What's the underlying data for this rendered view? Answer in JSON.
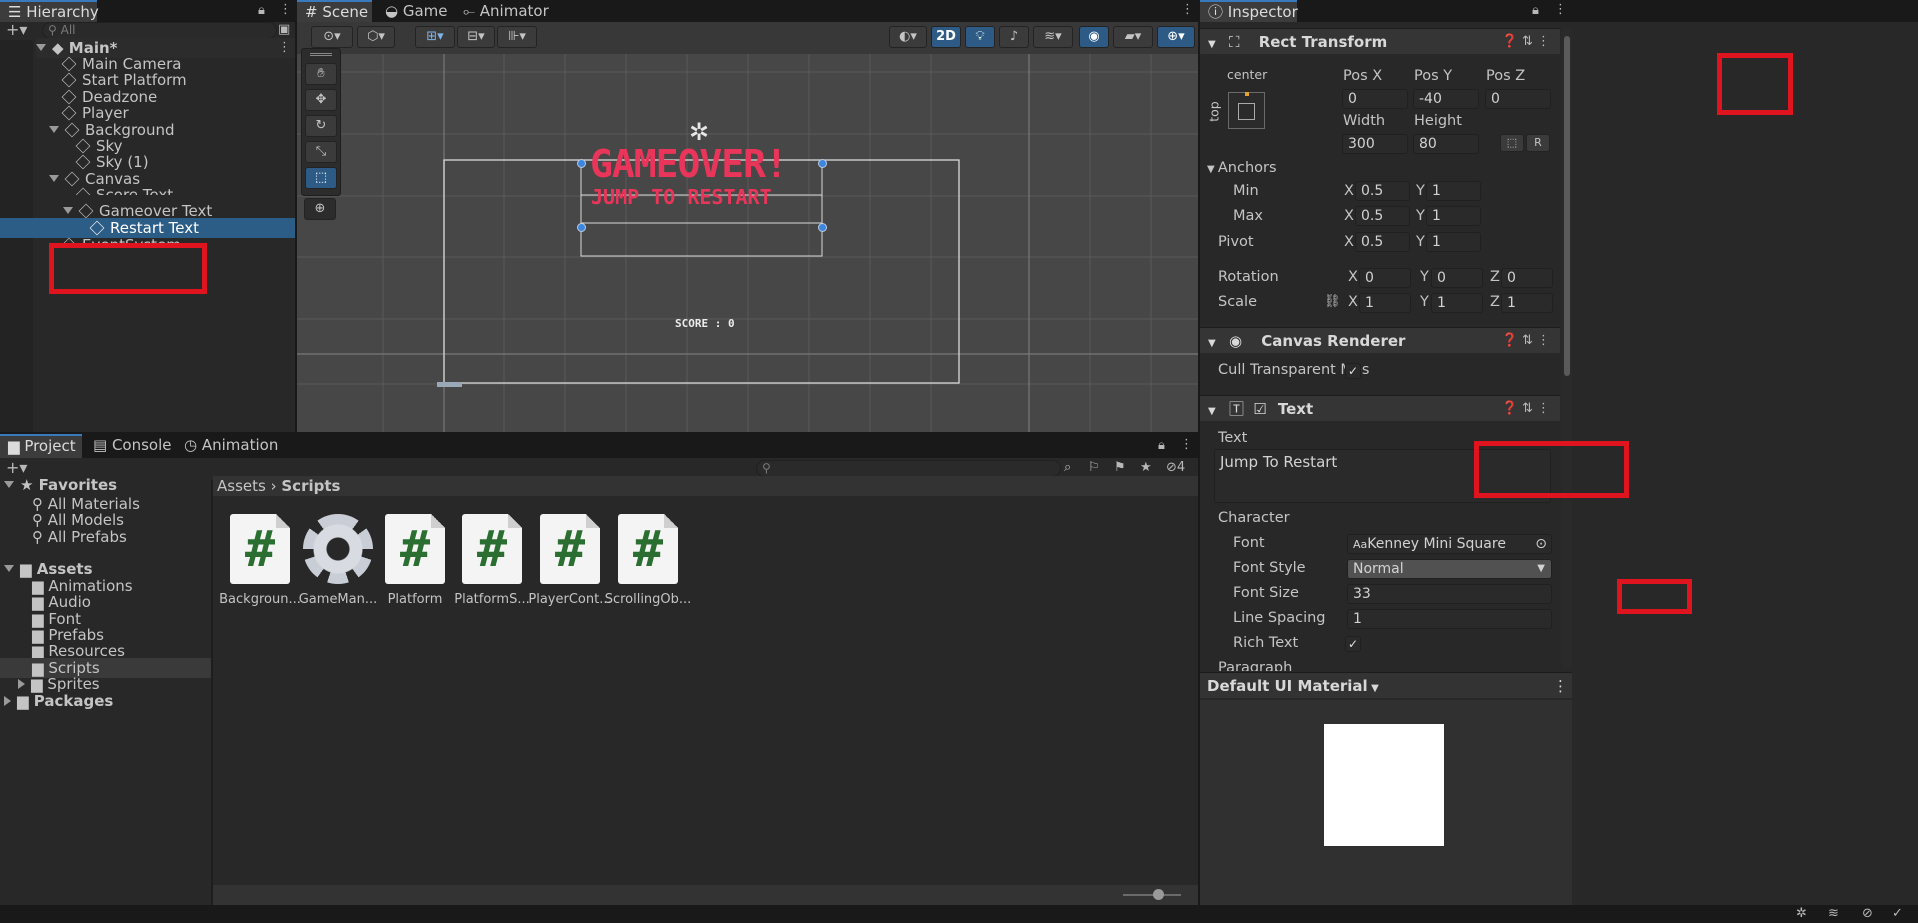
{
  "hierarchy": {
    "tab": "Hierarchy",
    "search_placeholder": "All",
    "scene": "Main*",
    "items": [
      {
        "label": "Main Camera"
      },
      {
        "label": "Start Platform"
      },
      {
        "label": "Deadzone"
      },
      {
        "label": "Player"
      },
      {
        "label": "Background"
      },
      {
        "label": "Sky"
      },
      {
        "label": "Sky (1)"
      },
      {
        "label": "Canvas"
      },
      {
        "label": "Score Text"
      },
      {
        "label": "Gameover Text"
      },
      {
        "label": "Restart Text"
      },
      {
        "label": "EventSystem"
      }
    ]
  },
  "scene": {
    "tabs": [
      "Scene",
      "Game",
      "Animator"
    ],
    "toolbar_2d": "2D",
    "gameover_text": "GAMEOVER!",
    "restart_text": "JUMP TO RESTART",
    "score_text": "SCORE : 0",
    "colors": {
      "accent": "#e9355a",
      "bg": "#474747"
    }
  },
  "inspector": {
    "tab": "Inspector",
    "rect_transform": {
      "title": "Rect Transform",
      "anchor_preset_h": "center",
      "anchor_preset_v": "top",
      "pos_x_label": "Pos X",
      "pos_x": "0",
      "pos_y_label": "Pos Y",
      "pos_y": "-40",
      "pos_z_label": "Pos Z",
      "pos_z": "0",
      "width_label": "Width",
      "width": "300",
      "height_label": "Height",
      "height": "80",
      "r_label": "R",
      "anchors_label": "Anchors",
      "min_label": "Min",
      "min_x": "0.5",
      "min_y": "1",
      "max_label": "Max",
      "max_x": "0.5",
      "max_y": "1",
      "pivot_label": "Pivot",
      "pivot_x": "0.5",
      "pivot_y": "1",
      "rotation_label": "Rotation",
      "rot_x": "0",
      "rot_y": "0",
      "rot_z": "0",
      "scale_label": "Scale",
      "scale_x": "1",
      "scale_y": "1",
      "scale_z": "1",
      "x": "X",
      "y": "Y",
      "z": "Z"
    },
    "canvas_renderer": {
      "title": "Canvas Renderer",
      "cull_label": "Cull Transparent Mes"
    },
    "text": {
      "title": "Text",
      "text_label": "Text",
      "text_value": "Jump To Restart",
      "character_label": "Character",
      "font_label": "Font",
      "font_value": "Kenney Mini Square",
      "font_style_label": "Font Style",
      "font_style_value": "Normal",
      "font_size_label": "Font Size",
      "font_size_value": "33",
      "line_spacing_label": "Line Spacing",
      "line_spacing_value": "1",
      "rich_text_label": "Rich Text",
      "paragraph_label": "Paragraph"
    },
    "material": "Default UI Material"
  },
  "project": {
    "tabs": [
      "Project",
      "Console",
      "Animation"
    ],
    "hidden_count": "4",
    "favorites_label": "Favorites",
    "favorites": [
      "All Materials",
      "All Models",
      "All Prefabs"
    ],
    "assets_label": "Assets",
    "folders": [
      "Animations",
      "Audio",
      "Font",
      "Prefabs",
      "Resources",
      "Scripts",
      "Sprites"
    ],
    "packages_label": "Packages",
    "breadcrumb": [
      "Assets",
      "Scripts"
    ],
    "files": [
      {
        "name": "Backgroun...",
        "icon": "script-icon"
      },
      {
        "name": "GameMan...",
        "icon": "gear-icon"
      },
      {
        "name": "Platform",
        "icon": "script-icon"
      },
      {
        "name": "PlatformS...",
        "icon": "script-icon"
      },
      {
        "name": "PlayerCont...",
        "icon": "script-icon"
      },
      {
        "name": "ScrollingOb...",
        "icon": "script-icon"
      }
    ]
  }
}
